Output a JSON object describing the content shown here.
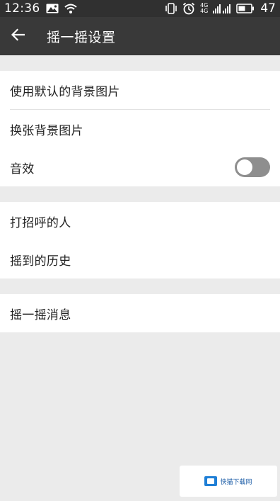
{
  "status_bar": {
    "time": "12:36",
    "network_line1": "4G",
    "network_line2": "4G",
    "battery": "47",
    "icons": [
      "image-icon",
      "wifi-icon",
      "vibrate-icon",
      "alarm-icon",
      "signal-icon",
      "battery-icon"
    ]
  },
  "app_bar": {
    "title": "摇一摇设置",
    "back_icon": "arrow-left-icon"
  },
  "settings": {
    "group1": {
      "default_background": "使用默认的背景图片",
      "change_background": "换张背景图片",
      "sound_effect": "音效",
      "sound_effect_enabled": false
    },
    "group2": {
      "greeters": "打招呼的人",
      "history": "摇到的历史"
    },
    "group3": {
      "messages": "摇一摇消息"
    }
  },
  "watermark": {
    "text": "快猫下载网"
  },
  "colors": {
    "status_bar": "#303030",
    "app_bar": "#393939",
    "background": "#ebebeb",
    "toggle_off": "#8e8e8e"
  }
}
